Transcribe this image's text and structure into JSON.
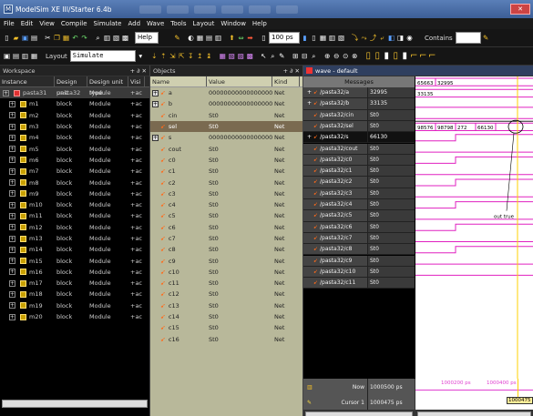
{
  "window": {
    "title": "ModelSim XE III/Starter 6.4b"
  },
  "menu": [
    "File",
    "Edit",
    "View",
    "Compile",
    "Simulate",
    "Add",
    "Wave",
    "Tools",
    "Layout",
    "Window",
    "Help"
  ],
  "toolbar": {
    "help_label": "Help",
    "run_length": "100 ps",
    "contains_label": "Contains",
    "layout_label": "Layout",
    "layout_value": "Simulate"
  },
  "workspace": {
    "title": "Workspace",
    "columns": [
      "Instance",
      "Design unit",
      "Design unit type",
      "Visi"
    ],
    "rows": [
      {
        "instance": "pasta31",
        "unit": "pasta32",
        "type": "Module",
        "vis": "+ac"
      },
      {
        "instance": "m1",
        "unit": "block",
        "type": "Module",
        "vis": "+ac"
      },
      {
        "instance": "m2",
        "unit": "block",
        "type": "Module",
        "vis": "+ac"
      },
      {
        "instance": "m3",
        "unit": "block",
        "type": "Module",
        "vis": "+ac"
      },
      {
        "instance": "m4",
        "unit": "block",
        "type": "Module",
        "vis": "+ac"
      },
      {
        "instance": "m5",
        "unit": "block",
        "type": "Module",
        "vis": "+ac"
      },
      {
        "instance": "m6",
        "unit": "block",
        "type": "Module",
        "vis": "+ac"
      },
      {
        "instance": "m7",
        "unit": "block",
        "type": "Module",
        "vis": "+ac"
      },
      {
        "instance": "m8",
        "unit": "block",
        "type": "Module",
        "vis": "+ac"
      },
      {
        "instance": "m9",
        "unit": "block",
        "type": "Module",
        "vis": "+ac"
      },
      {
        "instance": "m10",
        "unit": "block",
        "type": "Module",
        "vis": "+ac"
      },
      {
        "instance": "m11",
        "unit": "block",
        "type": "Module",
        "vis": "+ac"
      },
      {
        "instance": "m12",
        "unit": "block",
        "type": "Module",
        "vis": "+ac"
      },
      {
        "instance": "m13",
        "unit": "block",
        "type": "Module",
        "vis": "+ac"
      },
      {
        "instance": "m14",
        "unit": "block",
        "type": "Module",
        "vis": "+ac"
      },
      {
        "instance": "m15",
        "unit": "block",
        "type": "Module",
        "vis": "+ac"
      },
      {
        "instance": "m16",
        "unit": "block",
        "type": "Module",
        "vis": "+ac"
      },
      {
        "instance": "m17",
        "unit": "block",
        "type": "Module",
        "vis": "+ac"
      },
      {
        "instance": "m18",
        "unit": "block",
        "type": "Module",
        "vis": "+ac"
      },
      {
        "instance": "m19",
        "unit": "block",
        "type": "Module",
        "vis": "+ac"
      },
      {
        "instance": "m20",
        "unit": "block",
        "type": "Module",
        "vis": "+ac"
      }
    ]
  },
  "objects": {
    "title": "Objects",
    "columns": [
      "Name",
      "Value",
      "Kind"
    ],
    "rows": [
      {
        "name": "a",
        "value": "00000000000000000...",
        "kind": "Net",
        "expand": true
      },
      {
        "name": "b",
        "value": "00000000000000000...",
        "kind": "Net",
        "expand": true
      },
      {
        "name": "cin",
        "value": "St0",
        "kind": "Net"
      },
      {
        "name": "sel",
        "value": "St0",
        "kind": "Net",
        "selected": true
      },
      {
        "name": "s",
        "value": "00000000000000000...",
        "kind": "Net",
        "expand": true
      },
      {
        "name": "cout",
        "value": "St0",
        "kind": "Net"
      },
      {
        "name": "c0",
        "value": "St0",
        "kind": "Net"
      },
      {
        "name": "c1",
        "value": "St0",
        "kind": "Net"
      },
      {
        "name": "c2",
        "value": "St0",
        "kind": "Net"
      },
      {
        "name": "c3",
        "value": "St0",
        "kind": "Net"
      },
      {
        "name": "c4",
        "value": "St0",
        "kind": "Net"
      },
      {
        "name": "c5",
        "value": "St0",
        "kind": "Net"
      },
      {
        "name": "c6",
        "value": "St0",
        "kind": "Net"
      },
      {
        "name": "c7",
        "value": "St0",
        "kind": "Net"
      },
      {
        "name": "c8",
        "value": "St0",
        "kind": "Net"
      },
      {
        "name": "c9",
        "value": "St0",
        "kind": "Net"
      },
      {
        "name": "c10",
        "value": "St0",
        "kind": "Net"
      },
      {
        "name": "c11",
        "value": "St0",
        "kind": "Net"
      },
      {
        "name": "c12",
        "value": "St0",
        "kind": "Net"
      },
      {
        "name": "c13",
        "value": "St0",
        "kind": "Net"
      },
      {
        "name": "c14",
        "value": "St0",
        "kind": "Net"
      },
      {
        "name": "c15",
        "value": "St0",
        "kind": "Net"
      },
      {
        "name": "c16",
        "value": "St0",
        "kind": "Net"
      }
    ]
  },
  "wave": {
    "title": "wave - default",
    "messages_label": "Messages",
    "rows": [
      {
        "name": "/pasta32/a",
        "value": "32995",
        "expand": true
      },
      {
        "name": "/pasta32/b",
        "value": "33135",
        "expand": true
      },
      {
        "name": "/pasta32/cin",
        "value": "St0"
      },
      {
        "name": "/pasta32/sel",
        "value": "St0"
      },
      {
        "name": "/pasta32/s",
        "value": "66130",
        "expand": true,
        "selected": true
      },
      {
        "name": "/pasta32/cout",
        "value": "St0"
      },
      {
        "name": "/pasta32/c0",
        "value": "St0"
      },
      {
        "name": "/pasta32/c1",
        "value": "St0"
      },
      {
        "name": "/pasta32/c2",
        "value": "St0"
      },
      {
        "name": "/pasta32/c3",
        "value": "St0"
      },
      {
        "name": "/pasta32/c4",
        "value": "St0"
      },
      {
        "name": "/pasta32/c5",
        "value": "St0"
      },
      {
        "name": "/pasta32/c6",
        "value": "St0"
      },
      {
        "name": "/pasta32/c7",
        "value": "St0"
      },
      {
        "name": "/pasta32/c8",
        "value": "St0"
      },
      {
        "name": "/pasta32/c9",
        "value": "St0"
      },
      {
        "name": "/pasta32/c10",
        "value": "St0"
      },
      {
        "name": "/pasta32/c11",
        "value": "St0"
      }
    ],
    "bus_a": [
      "65663",
      "32995"
    ],
    "bus_b": [
      "33135"
    ],
    "bus_s": [
      "98576",
      "98798",
      "272",
      "66130"
    ],
    "annotation": "out true",
    "now_label": "Now",
    "now_value": "1000500 ps",
    "cursor_label": "Cursor 1",
    "cursor_value": "1000475 ps",
    "cursor_box": "1000475",
    "timeline": [
      "1000200 ps",
      "1000400 ps"
    ]
  }
}
